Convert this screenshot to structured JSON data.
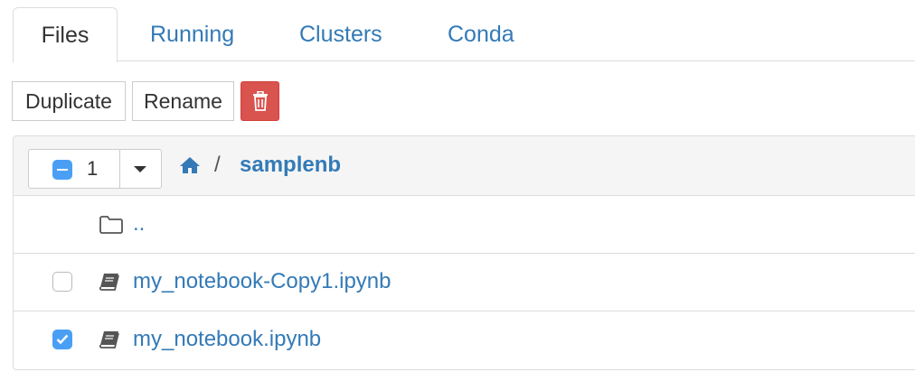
{
  "tabs": [
    {
      "label": "Files"
    },
    {
      "label": "Running"
    },
    {
      "label": "Clusters"
    },
    {
      "label": "Conda"
    }
  ],
  "toolbar": {
    "duplicate_label": "Duplicate",
    "rename_label": "Rename",
    "delete_icon": "trash-icon"
  },
  "selection": {
    "count": "1"
  },
  "breadcrumb": {
    "home_icon": "home-icon",
    "separator": "/",
    "current_dir": "samplenb"
  },
  "file_list": [
    {
      "name": "..",
      "type": "folder",
      "checked": false
    },
    {
      "name": "my_notebook-Copy1.ipynb",
      "type": "notebook",
      "checked": false
    },
    {
      "name": "my_notebook.ipynb",
      "type": "notebook",
      "checked": true
    }
  ],
  "colors": {
    "link": "#337ab7",
    "danger": "#d9534f",
    "check": "#4a9ff5"
  }
}
